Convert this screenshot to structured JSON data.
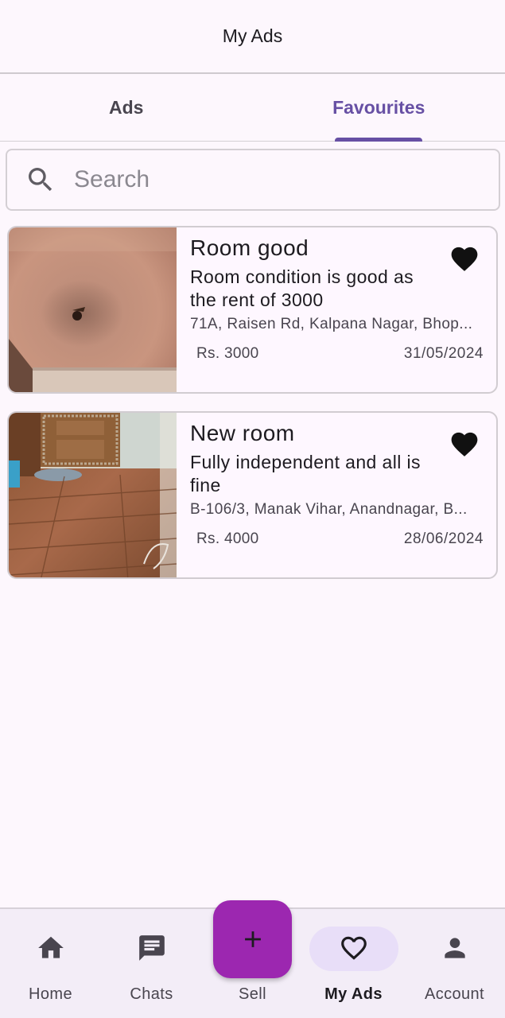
{
  "topbar": {
    "title": "My Ads"
  },
  "tabs": [
    {
      "label": "Ads",
      "active": false
    },
    {
      "label": "Favourites",
      "active": true
    }
  ],
  "search": {
    "placeholder": "Search",
    "value": "",
    "icon": "search-icon"
  },
  "listings": [
    {
      "title": "Room good",
      "description": "Room condition is good as the rent of 3000",
      "address": "71A, Raisen Rd, Kalpana Nagar, Bhop...",
      "price": "Rs. 3000",
      "date": "31/05/2024",
      "favourite": true,
      "favourite_icon": "heart-filled-icon"
    },
    {
      "title": "New room",
      "description": "Fully independent and all is fine",
      "address": "B-106/3, Manak Vihar, Anandnagar, B...",
      "price": "Rs. 4000",
      "date": "28/06/2024",
      "favourite": true,
      "favourite_icon": "heart-filled-icon"
    }
  ],
  "bottom_nav": [
    {
      "label": "Home",
      "icon": "home-icon",
      "active": false
    },
    {
      "label": "Chats",
      "icon": "chat-icon",
      "active": false
    },
    {
      "label": "Sell",
      "icon": "plus-icon",
      "active": false
    },
    {
      "label": "My Ads",
      "icon": "heart-outline-icon",
      "active": true
    },
    {
      "label": "Account",
      "icon": "person-icon",
      "active": false
    }
  ],
  "colors": {
    "accent": "#6750a4",
    "fab": "#9c27b0",
    "background": "#fdf7fd",
    "nav_background": "#f3edf7",
    "active_pill": "#e8def8"
  }
}
